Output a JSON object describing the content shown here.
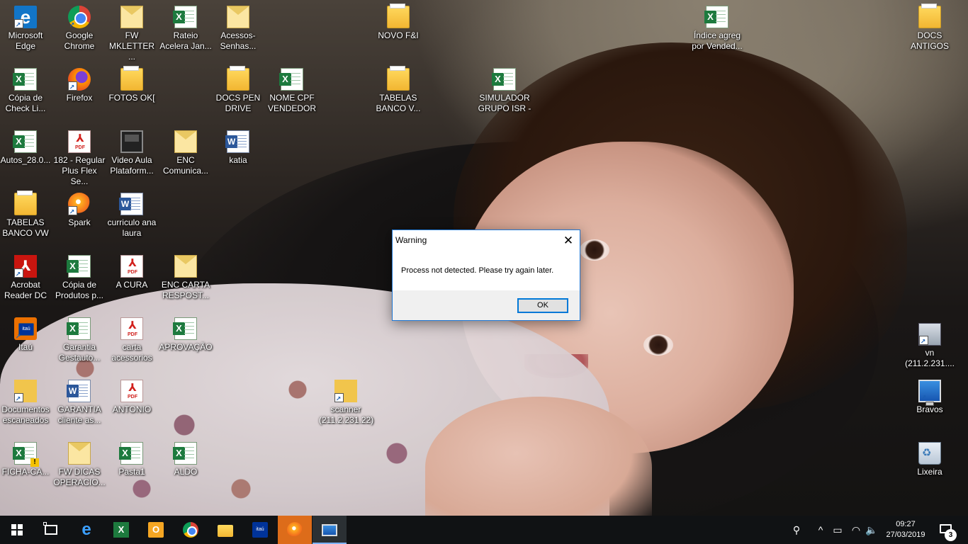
{
  "desktop": {
    "icons": [
      {
        "label": "Microsoft\nEdge",
        "type": "edge"
      },
      {
        "label": "Google\nChrome",
        "type": "chrome"
      },
      {
        "label": "FW\nMKLETTER ...",
        "type": "mail"
      },
      {
        "label": "Rateio\nAcelera Jan...",
        "type": "excel"
      },
      {
        "label": "Acessos-\nSenhas...",
        "type": "mail"
      },
      {
        "label": "NOVO F&I",
        "type": "folder"
      },
      {
        "label": "Índice agreg\npor Vended...",
        "type": "excel"
      },
      {
        "label": "DOCS\nANTIGOS",
        "type": "folder"
      },
      {
        "label": "Cópia de\nCheck Li...",
        "type": "excel"
      },
      {
        "label": "Firefox",
        "type": "firefox"
      },
      {
        "label": "FOTOS OK[",
        "type": "folder"
      },
      {
        "label": "DOCS PEN\nDRIVE",
        "type": "folder"
      },
      {
        "label": "NOME CPF\nVENDEDOR",
        "type": "excel"
      },
      {
        "label": "TABELAS\nBANCO V...",
        "type": "folder"
      },
      {
        "label": "SIMULADOR\nGRUPO ISR -",
        "type": "excel"
      },
      {
        "label": "Autos_28.0...",
        "type": "excel"
      },
      {
        "label": "182 - Regular\nPlus Flex Se...",
        "type": "pdf"
      },
      {
        "label": "Video Aula\nPlataform...",
        "type": "video"
      },
      {
        "label": "ENC\nComunica...",
        "type": "mail"
      },
      {
        "label": "katia",
        "type": "word"
      },
      {
        "label": "TABELAS\nBANCO VW",
        "type": "folder"
      },
      {
        "label": "Spark",
        "type": "spark"
      },
      {
        "label": "curriculo ana\nlaura",
        "type": "word"
      },
      {
        "label": "Acrobat\nReader DC",
        "type": "acrobat"
      },
      {
        "label": "Cópia de\nProdutos p...",
        "type": "excel"
      },
      {
        "label": "A CURA",
        "type": "pdf"
      },
      {
        "label": "ENC CARTA\nRESPOST...",
        "type": "mail"
      },
      {
        "label": "Itaú",
        "type": "itau"
      },
      {
        "label": "Garantia\nGestauto...",
        "type": "excel"
      },
      {
        "label": "carta\nacessorios",
        "type": "pdf"
      },
      {
        "label": "APROVAÇÃO",
        "type": "excel"
      },
      {
        "label": "vn\n(211.2.231....",
        "type": "network"
      },
      {
        "label": "Documentos\nescaneados",
        "type": "docscan"
      },
      {
        "label": "GARANTIA\ncliente as...",
        "type": "word"
      },
      {
        "label": "ANTONIO",
        "type": "pdf"
      },
      {
        "label": "scanner\n(211.2.231.22)",
        "type": "docscan"
      },
      {
        "label": "Bravos",
        "type": "pc"
      },
      {
        "label": "FICHA-CA...",
        "type": "excelwarn"
      },
      {
        "label": "FW DICAS\nOPERACIO...",
        "type": "mail"
      },
      {
        "label": "Pasta1",
        "type": "excel"
      },
      {
        "label": "ALDO",
        "type": "excel"
      },
      {
        "label": "Lixeira",
        "type": "recycle"
      }
    ]
  },
  "dialog": {
    "title": "Warning",
    "close_glyph": "✕",
    "message": "Process not detected. Please try again later.",
    "ok_label": "OK"
  },
  "taskbar": {
    "edge_glyph": "e",
    "excel_glyph": "X",
    "outlook_glyph": "O",
    "itau_label": "itaú",
    "tray_people_glyph": "⚲",
    "tray_chevron_glyph": "^",
    "tray_battery_glyph": "▭",
    "tray_wifi_glyph": "◠",
    "tray_volume_glyph": "🔈",
    "time": "09:27",
    "date": "27/03/2019",
    "notification_count": "3"
  }
}
